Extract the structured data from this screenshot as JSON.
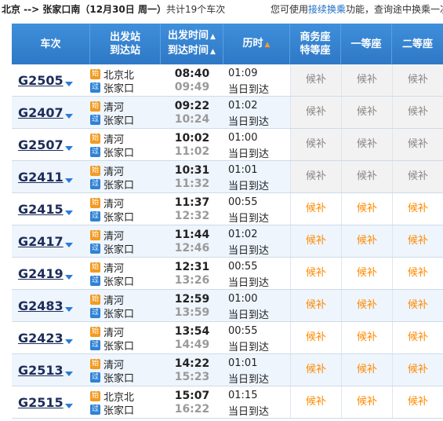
{
  "header_bar": {
    "route": "北京 --> 张家口南（12月30日  周一）",
    "count_text": "共计19个车次",
    "hint_prefix": "您可使用",
    "hint_link": "接续换乘",
    "hint_suffix": "功能，查询途中换乘一次"
  },
  "columns": {
    "train": "车次",
    "station_1": "出发站",
    "station_2": "到达站",
    "time_1": "出发时间",
    "time_2": "到达时间",
    "duration": "历时",
    "seat_business_1": "商务座",
    "seat_business_2": "特等座",
    "seat_first": "一等座",
    "seat_second": "二等座"
  },
  "sort_arrows": {
    "up": "▲",
    "down": "▲"
  },
  "badges": {
    "start": "始",
    "pass": "过"
  },
  "colors": {
    "header_bg": "#2e78c6",
    "link": "#1f6fc5",
    "waitlist_available": "#ff8a00",
    "waitlist_gray": "#888888"
  },
  "trains": [
    {
      "no": "G2505",
      "from": "北京北",
      "to": "张家口",
      "dep": "08:40",
      "arr": "09:49",
      "dur": "01:09",
      "arrive_day": "当日到达",
      "business": "候补",
      "first": "候补",
      "second": "候补",
      "available": false
    },
    {
      "no": "G2407",
      "from": "清河",
      "to": "张家口",
      "dep": "09:22",
      "arr": "10:24",
      "dur": "01:02",
      "arrive_day": "当日到达",
      "business": "候补",
      "first": "候补",
      "second": "候补",
      "available": false
    },
    {
      "no": "G2507",
      "from": "清河",
      "to": "张家口",
      "dep": "10:02",
      "arr": "11:02",
      "dur": "01:00",
      "arrive_day": "当日到达",
      "business": "候补",
      "first": "候补",
      "second": "候补",
      "available": false
    },
    {
      "no": "G2411",
      "from": "清河",
      "to": "张家口",
      "dep": "10:31",
      "arr": "11:32",
      "dur": "01:01",
      "arrive_day": "当日到达",
      "business": "候补",
      "first": "候补",
      "second": "候补",
      "available": false
    },
    {
      "no": "G2415",
      "from": "清河",
      "to": "张家口",
      "dep": "11:37",
      "arr": "12:32",
      "dur": "00:55",
      "arrive_day": "当日到达",
      "business": "候补",
      "first": "候补",
      "second": "候补",
      "available": true
    },
    {
      "no": "G2417",
      "from": "清河",
      "to": "张家口",
      "dep": "11:44",
      "arr": "12:46",
      "dur": "01:02",
      "arrive_day": "当日到达",
      "business": "候补",
      "first": "候补",
      "second": "候补",
      "available": true
    },
    {
      "no": "G2419",
      "from": "清河",
      "to": "张家口",
      "dep": "12:31",
      "arr": "13:26",
      "dur": "00:55",
      "arrive_day": "当日到达",
      "business": "候补",
      "first": "候补",
      "second": "候补",
      "available": true
    },
    {
      "no": "G2483",
      "from": "清河",
      "to": "张家口",
      "dep": "12:59",
      "arr": "13:59",
      "dur": "01:00",
      "arrive_day": "当日到达",
      "business": "候补",
      "first": "候补",
      "second": "候补",
      "available": true
    },
    {
      "no": "G2423",
      "from": "清河",
      "to": "张家口",
      "dep": "13:54",
      "arr": "14:49",
      "dur": "00:55",
      "arrive_day": "当日到达",
      "business": "候补",
      "first": "候补",
      "second": "候补",
      "available": true
    },
    {
      "no": "G2513",
      "from": "清河",
      "to": "张家口",
      "dep": "14:22",
      "arr": "15:23",
      "dur": "01:01",
      "arrive_day": "当日到达",
      "business": "候补",
      "first": "候补",
      "second": "候补",
      "available": true
    },
    {
      "no": "G2515",
      "from": "北京北",
      "to": "张家口",
      "dep": "15:07",
      "arr": "16:22",
      "dur": "01:15",
      "arrive_day": "当日到达",
      "business": "候补",
      "first": "候补",
      "second": "候补",
      "available": true
    }
  ]
}
